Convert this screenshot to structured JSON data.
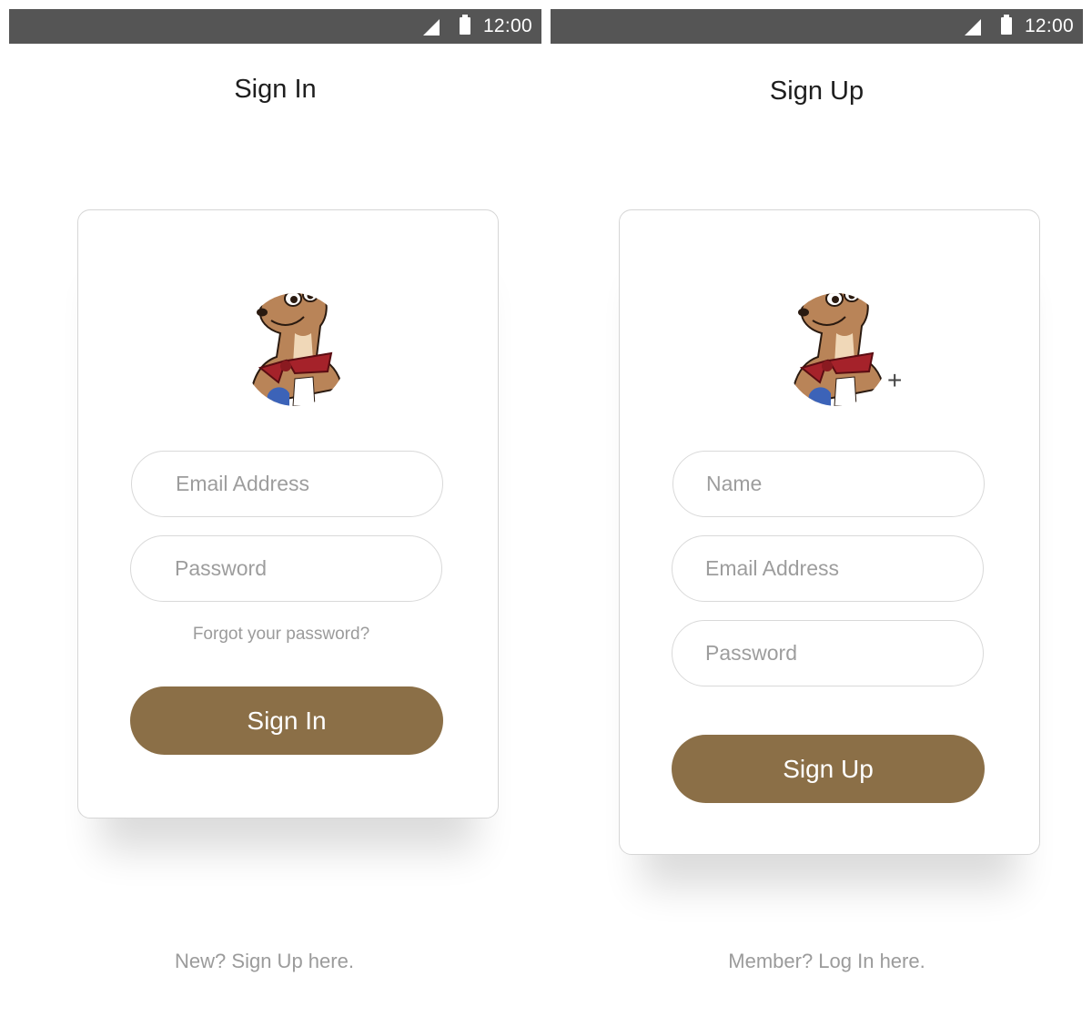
{
  "colors": {
    "status_bar": "#555555",
    "primary_button": "#8b6f47",
    "placeholder_text": "#9d9d9d",
    "card_border": "#d6d6d6"
  },
  "status_bar": {
    "time": "12:00",
    "signal_icon": "signal-icon",
    "battery_icon": "battery-icon"
  },
  "sign_in": {
    "title": "Sign In",
    "email_placeholder": "Email Address",
    "password_placeholder": "Password",
    "forgot_link": "Forgot your password?",
    "submit_label": "Sign In",
    "footer_link": "New? Sign Up here."
  },
  "sign_up": {
    "title": "Sign Up",
    "name_placeholder": "Name",
    "email_placeholder": "Email Address",
    "password_placeholder": "Password",
    "add_photo_icon": "+",
    "submit_label": "Sign Up",
    "footer_link": "Member? Log In here."
  }
}
